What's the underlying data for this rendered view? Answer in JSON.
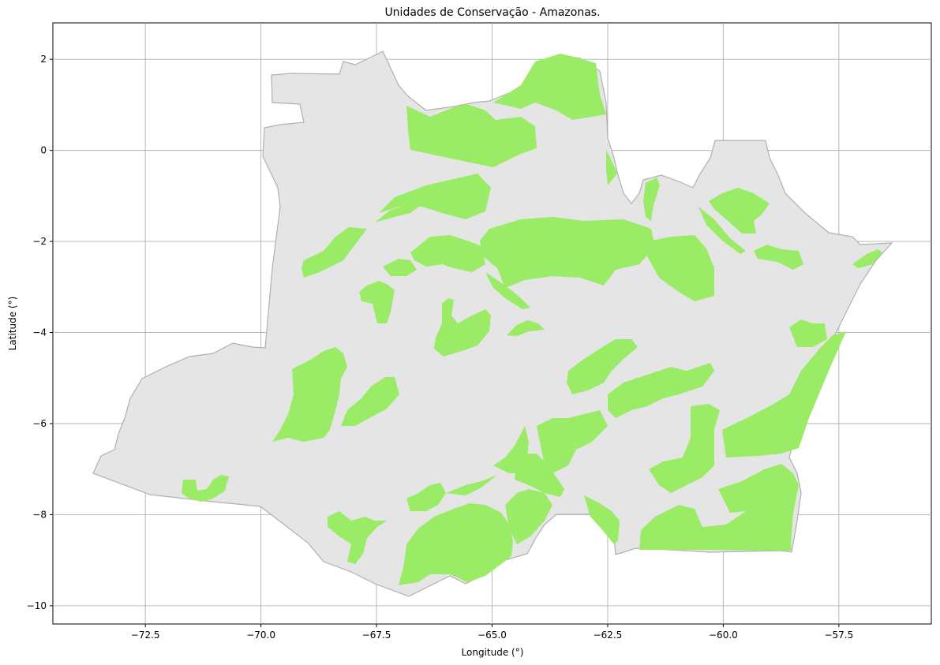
{
  "chart_data": {
    "type": "map",
    "title": "Unidades de Conservação - Amazonas.",
    "xlabel": "Longitude (°)",
    "ylabel": "Latitude (°)",
    "xlim": [
      -74.5,
      -55.5
    ],
    "ylim": [
      -10.4,
      2.8
    ],
    "grid": true,
    "xticks": [
      -72.5,
      -70.0,
      -67.5,
      -65.0,
      -62.5,
      -60.0,
      -57.5
    ],
    "yticks": [
      2,
      0,
      -2,
      -4,
      -6,
      -8,
      -10
    ],
    "xtick_labels": [
      "−72.5",
      "−70.0",
      "−67.5",
      "−65.0",
      "−62.5",
      "−60.0",
      "−57.5"
    ],
    "ytick_labels": [
      "2",
      "0",
      "−2",
      "−4",
      "−6",
      "−8",
      "−10"
    ],
    "colors": {
      "state_fill": "#e5e5e5",
      "state_edge": "#b0b0b0",
      "units_fill": "#9aeb65",
      "grid": "#b0b0b0"
    }
  }
}
